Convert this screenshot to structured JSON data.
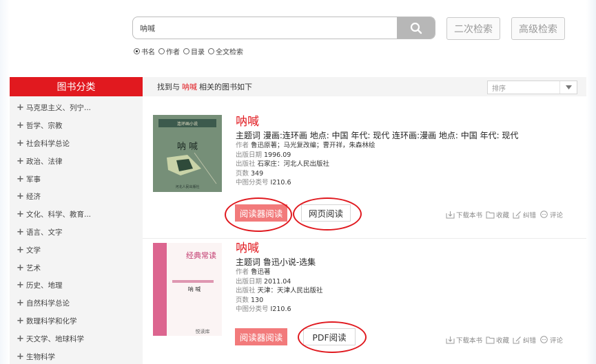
{
  "search": {
    "query": "呐喊",
    "buttons": {
      "secondary": "二次检索",
      "advanced": "高级检索"
    },
    "scopes": [
      {
        "label": "书名",
        "selected": true
      },
      {
        "label": "作者",
        "selected": false
      },
      {
        "label": "目录",
        "selected": false
      },
      {
        "label": "全文检索",
        "selected": false
      }
    ]
  },
  "sidebar": {
    "title": "图书分类",
    "items": [
      "马克思主义、列宁...",
      "哲学、宗教",
      "社会科学总论",
      "政治、法律",
      "军事",
      "经济",
      "文化、科学、教育...",
      "语言、文字",
      "文学",
      "艺术",
      "历史、地理",
      "自然科学总论",
      "数理科学和化学",
      "天文学、地球科学",
      "生物科学"
    ]
  },
  "results": {
    "prefix": "找到与",
    "keyword": "呐喊",
    "suffix": "相关的图书如下",
    "sort_placeholder": "排序"
  },
  "labels": {
    "author": "作者",
    "date": "出版日期",
    "publisher": "出版社",
    "pages": "页数",
    "clc": "中图分类号",
    "subject_prefix": "主题词"
  },
  "books": [
    {
      "title": "呐喊",
      "subject": "漫画:连环画 地点: 中国 年代: 现代 连环画:漫画 地点: 中国 年代: 现代",
      "author": "鲁迅原著；马光复改编；曹开祥，朱森林绘",
      "date": "1996.09",
      "publisher": "石家庄：河北人民出版社",
      "pages": "349",
      "clc": "I210.6",
      "reader_button": "阅读器阅读",
      "read_button": "网页阅读",
      "cover": {
        "top_text": "连环画小说",
        "title": "呐 喊",
        "bottom_text": "河北人民出版社"
      }
    },
    {
      "title": "呐喊",
      "subject": "鲁迅小说-选集",
      "author": "鲁迅著",
      "date": "2011.04",
      "publisher": "天津：天津人民出版社",
      "pages": "130",
      "clc": "I210.6",
      "reader_button": "阅读器阅读",
      "read_button": "PDF阅读",
      "cover": {
        "series": "经典常读",
        "title": "呐 喊",
        "logo": "悦读库"
      }
    }
  ],
  "actions": {
    "download": "下载本书",
    "favorite": "收藏",
    "correct": "纠错",
    "comment": "评论"
  },
  "colors": {
    "brand_red": "#e1191f",
    "reader_button": "#f27a7b"
  }
}
